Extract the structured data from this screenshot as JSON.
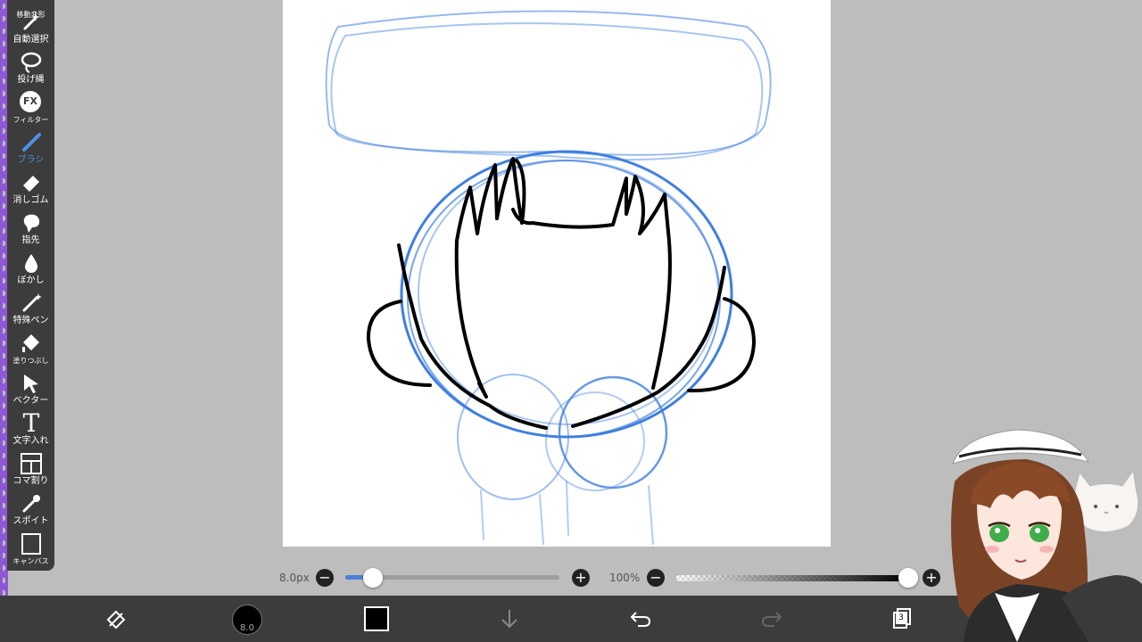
{
  "toolbar": {
    "tools": [
      {
        "label": "移動変形"
      },
      {
        "label": "自動選択"
      },
      {
        "label": "投げ縄"
      },
      {
        "label": "フィルター",
        "icon_text": "FX"
      },
      {
        "label": "ブラシ",
        "active": true
      },
      {
        "label": "消しゴム"
      },
      {
        "label": "指先"
      },
      {
        "label": "ぼかし"
      },
      {
        "label": "特殊ペン"
      },
      {
        "label": "塗りつぶし"
      },
      {
        "label": "ベクター"
      },
      {
        "label": "文字入れ",
        "icon_text": "T"
      },
      {
        "label": "コマ割り"
      },
      {
        "label": "スポイト"
      },
      {
        "label": "キャンバス"
      }
    ]
  },
  "brush_size": {
    "label": "8.0px",
    "value_fraction": 0.13,
    "minus": "−",
    "plus": "+"
  },
  "opacity": {
    "label": "100%",
    "value_fraction": 1.0,
    "minus": "−",
    "plus": "+"
  },
  "bottom_bar": {
    "brush_preview_value": "8.0",
    "current_color": "#000000",
    "layer_count": "3",
    "icons": [
      "transform-icon",
      "brush-size-icon",
      "color-icon",
      "download-icon",
      "undo-icon",
      "redo-icon",
      "layers-icon"
    ]
  },
  "colors": {
    "accent": "#4f8fe6",
    "sketch_blue": "#3f7fe0",
    "ink": "#000000",
    "toolbar_bg": "#3c3c3c",
    "workspace_bg": "#bdbdbd",
    "edge_purple": "#8e57d6"
  }
}
